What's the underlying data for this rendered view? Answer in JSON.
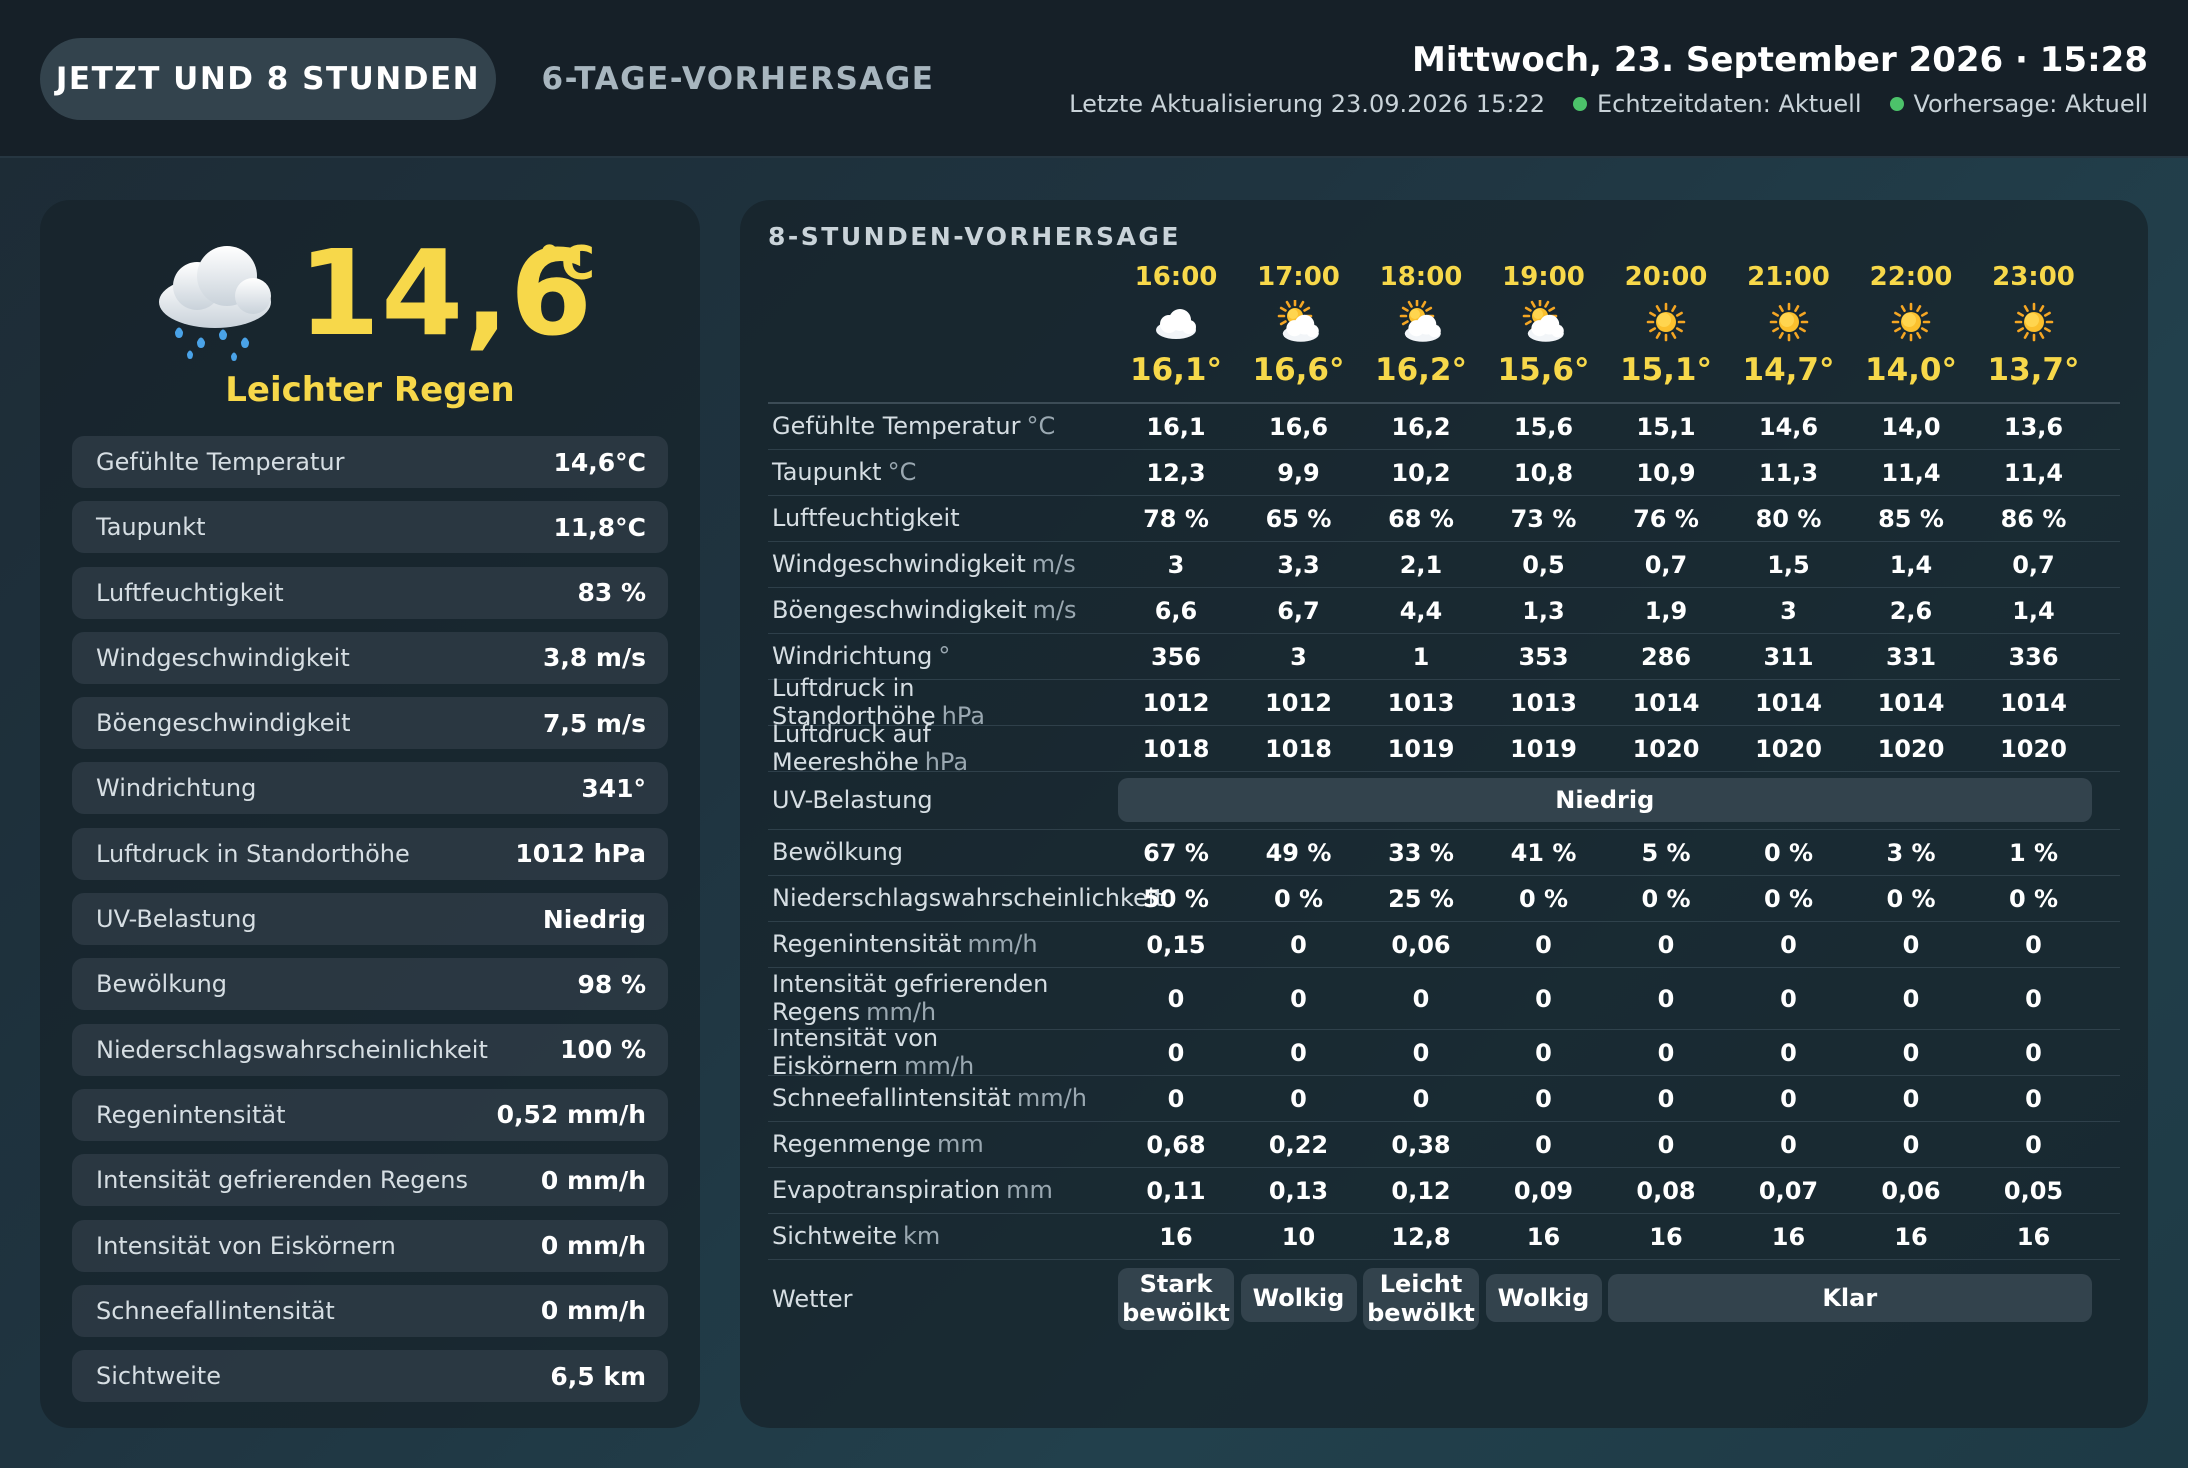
{
  "tabs": [
    {
      "label": "JETZT UND 8 STUNDEN",
      "active": true
    },
    {
      "label": "6-TAGE-VORHERSAGE",
      "active": false
    }
  ],
  "header": {
    "datetime": "Mittwoch, 23. September 2026 · 15:28",
    "last_update": "Letzte Aktualisierung 23.09.2026 15:22",
    "realtime_status": "Echtzeitdaten: Aktuell",
    "forecast_status": "Vorhersage: Aktuell",
    "status_color": "#4cc26a"
  },
  "current": {
    "icon": "cloud-rain-icon",
    "temperature": "14,6",
    "unit": "°C",
    "condition": "Leichter Regen",
    "rows": [
      {
        "label": "Gefühlte Temperatur",
        "value": "14,6°C"
      },
      {
        "label": "Taupunkt",
        "value": "11,8°C"
      },
      {
        "label": "Luftfeuchtigkeit",
        "value": "83 %"
      },
      {
        "label": "Windgeschwindigkeit",
        "value": "3,8 m/s"
      },
      {
        "label": "Böengeschwindigkeit",
        "value": "7,5 m/s"
      },
      {
        "label": "Windrichtung",
        "value": "341°"
      },
      {
        "label": "Luftdruck in Standorthöhe",
        "value": "1012 hPa"
      },
      {
        "label": "UV-Belastung",
        "value": "Niedrig"
      },
      {
        "label": "Bewölkung",
        "value": "98 %"
      },
      {
        "label": "Niederschlagswahrscheinlichkeit",
        "value": "100 %"
      },
      {
        "label": "Regenintensität",
        "value": "0,52 mm/h"
      },
      {
        "label": "Intensität gefrierenden Regens",
        "value": "0 mm/h"
      },
      {
        "label": "Intensität von Eiskörnern",
        "value": "0 mm/h"
      },
      {
        "label": "Schneefallintensität",
        "value": "0 mm/h"
      },
      {
        "label": "Sichtweite",
        "value": "6,5 km"
      }
    ]
  },
  "forecast": {
    "title": "8-STUNDEN-VORHERSAGE",
    "hours": [
      {
        "time": "16:00",
        "icon": "cloud-icon",
        "temp": "16,1°"
      },
      {
        "time": "17:00",
        "icon": "sun-behind-cloud-icon",
        "temp": "16,6°"
      },
      {
        "time": "18:00",
        "icon": "sun-behind-cloud-icon",
        "temp": "16,2°"
      },
      {
        "time": "19:00",
        "icon": "sun-behind-cloud-icon",
        "temp": "15,6°"
      },
      {
        "time": "20:00",
        "icon": "sun-icon",
        "temp": "15,1°"
      },
      {
        "time": "21:00",
        "icon": "sun-icon",
        "temp": "14,7°"
      },
      {
        "time": "22:00",
        "icon": "sun-icon",
        "temp": "14,0°"
      },
      {
        "time": "23:00",
        "icon": "sun-icon",
        "temp": "13,7°"
      }
    ],
    "rows": [
      {
        "label": "Gefühlte Temperatur",
        "unit": "°C",
        "values": [
          "16,1",
          "16,6",
          "16,2",
          "15,6",
          "15,1",
          "14,6",
          "14,0",
          "13,6"
        ]
      },
      {
        "label": "Taupunkt",
        "unit": "°C",
        "values": [
          "12,3",
          "9,9",
          "10,2",
          "10,8",
          "10,9",
          "11,3",
          "11,4",
          "11,4"
        ]
      },
      {
        "label": "Luftfeuchtigkeit",
        "unit": "",
        "values": [
          "78 %",
          "65 %",
          "68 %",
          "73 %",
          "76 %",
          "80 %",
          "85 %",
          "86 %"
        ]
      },
      {
        "label": "Windgeschwindigkeit",
        "unit": "m/s",
        "values": [
          "3",
          "3,3",
          "2,1",
          "0,5",
          "0,7",
          "1,5",
          "1,4",
          "0,7"
        ]
      },
      {
        "label": "Böengeschwindigkeit",
        "unit": "m/s",
        "values": [
          "6,6",
          "6,7",
          "4,4",
          "1,3",
          "1,9",
          "3",
          "2,6",
          "1,4"
        ]
      },
      {
        "label": "Windrichtung",
        "unit": "°",
        "values": [
          "356",
          "3",
          "1",
          "353",
          "286",
          "311",
          "331",
          "336"
        ]
      },
      {
        "label": "Luftdruck in Standorthöhe",
        "unit": "hPa",
        "values": [
          "1012",
          "1012",
          "1013",
          "1013",
          "1014",
          "1014",
          "1014",
          "1014"
        ]
      },
      {
        "label": "Luftdruck auf Meereshöhe",
        "unit": "hPa",
        "values": [
          "1018",
          "1018",
          "1019",
          "1019",
          "1020",
          "1020",
          "1020",
          "1020"
        ]
      },
      {
        "label": "UV-Belastung",
        "unit": "",
        "span": {
          "label": "Niedrig",
          "from": 0,
          "to": 7
        }
      },
      {
        "label": "Bewölkung",
        "unit": "",
        "values": [
          "67 %",
          "49 %",
          "33 %",
          "41 %",
          "5 %",
          "0 %",
          "3 %",
          "1 %"
        ]
      },
      {
        "label": "Niederschlagswahrscheinlichkeit",
        "unit": "",
        "values": [
          "50 %",
          "0 %",
          "25 %",
          "0 %",
          "0 %",
          "0 %",
          "0 %",
          "0 %"
        ]
      },
      {
        "label": "Regenintensität",
        "unit": "mm/h",
        "values": [
          "0,15",
          "0",
          "0,06",
          "0",
          "0",
          "0",
          "0",
          "0"
        ]
      },
      {
        "label": "Intensität gefrierenden Regens",
        "unit": "mm/h",
        "values": [
          "0",
          "0",
          "0",
          "0",
          "0",
          "0",
          "0",
          "0"
        ]
      },
      {
        "label": "Intensität von Eiskörnern",
        "unit": "mm/h",
        "values": [
          "0",
          "0",
          "0",
          "0",
          "0",
          "0",
          "0",
          "0"
        ]
      },
      {
        "label": "Schneefallintensität",
        "unit": "mm/h",
        "values": [
          "0",
          "0",
          "0",
          "0",
          "0",
          "0",
          "0",
          "0"
        ]
      },
      {
        "label": "Regenmenge",
        "unit": "mm",
        "values": [
          "0,68",
          "0,22",
          "0,38",
          "0",
          "0",
          "0",
          "0",
          "0"
        ]
      },
      {
        "label": "Evapotranspiration",
        "unit": "mm",
        "values": [
          "0,11",
          "0,13",
          "0,12",
          "0,09",
          "0,08",
          "0,07",
          "0,06",
          "0,05"
        ]
      },
      {
        "label": "Sichtweite",
        "unit": "km",
        "values": [
          "16",
          "10",
          "12,8",
          "16",
          "16",
          "16",
          "16",
          "16"
        ]
      },
      {
        "label": "Wetter",
        "unit": "",
        "pills": [
          {
            "label": "Stark bewölkt",
            "from": 0,
            "to": 0
          },
          {
            "label": "Wolkig",
            "from": 1,
            "to": 1
          },
          {
            "label": "Leicht bewölkt",
            "from": 2,
            "to": 2
          },
          {
            "label": "Wolkig",
            "from": 3,
            "to": 3
          },
          {
            "label": "Klar",
            "from": 4,
            "to": 7
          }
        ]
      }
    ]
  }
}
